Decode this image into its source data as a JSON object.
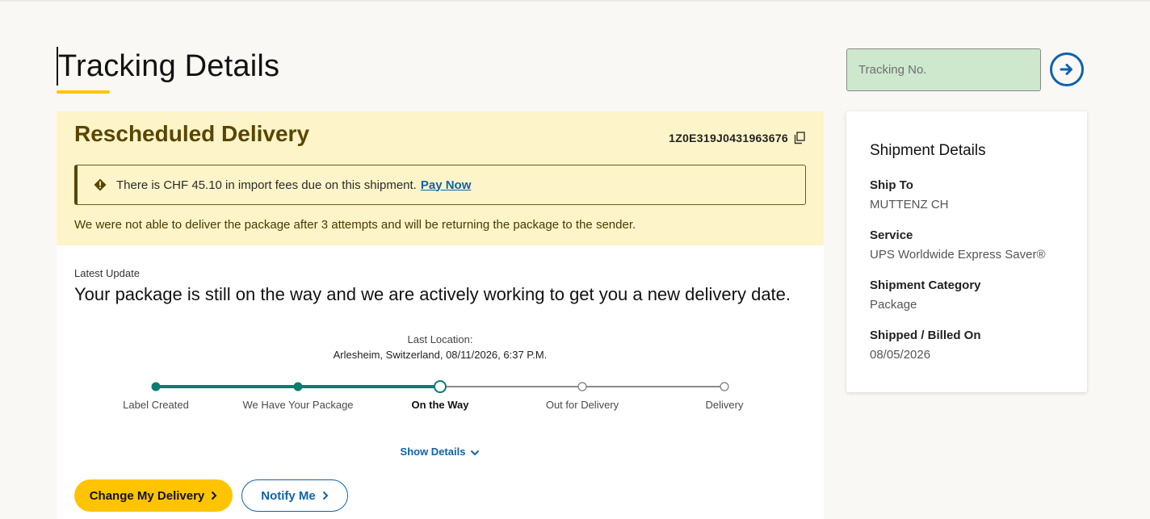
{
  "page": {
    "title": "Tracking Details"
  },
  "search": {
    "placeholder": "Tracking No."
  },
  "status": {
    "title": "Rescheduled Delivery",
    "tracking_number": "1Z0E319J0431963676",
    "fee_notice": "There is CHF 45.10 in import fees due on this shipment.",
    "pay_link": "Pay Now",
    "message": "We were not able to deliver the package after 3 attempts and will be returning the package to the sender."
  },
  "latest": {
    "label": "Latest Update",
    "text": "Your package is still on the way and we are actively working to get you a new delivery date."
  },
  "location": {
    "label": "Last Location:",
    "value": "Arlesheim, Switzerland, 08/11/2026, 6:37 P.M."
  },
  "progress": {
    "current_step": 3,
    "steps": [
      {
        "label": "Label Created"
      },
      {
        "label": "We Have Your Package"
      },
      {
        "label": "On the Way"
      },
      {
        "label": "Out for Delivery"
      },
      {
        "label": "Delivery"
      }
    ]
  },
  "actions": {
    "show_details": "Show Details",
    "change_delivery": "Change My Delivery",
    "notify": "Notify Me"
  },
  "shipment": {
    "title": "Shipment Details",
    "items": [
      {
        "key": "Ship To",
        "value": "MUTTENZ CH"
      },
      {
        "key": "Service",
        "value": "UPS Worldwide Express Saver®"
      },
      {
        "key": "Shipment Category",
        "value": "Package"
      },
      {
        "key": "Shipped / Billed On",
        "value": "08/05/2026"
      }
    ]
  },
  "colors": {
    "accent_yellow": "#ffc400",
    "link_blue": "#0f62ad",
    "progress_green": "#0a7c71",
    "alert_bg": "#fdf5c9",
    "input_bg": "#cde8cd"
  },
  "icons": {
    "go": "arrow-right-circle-icon",
    "copy": "copy-icon",
    "warning": "warning-diamond-icon",
    "expand": "chevron-down-icon"
  }
}
